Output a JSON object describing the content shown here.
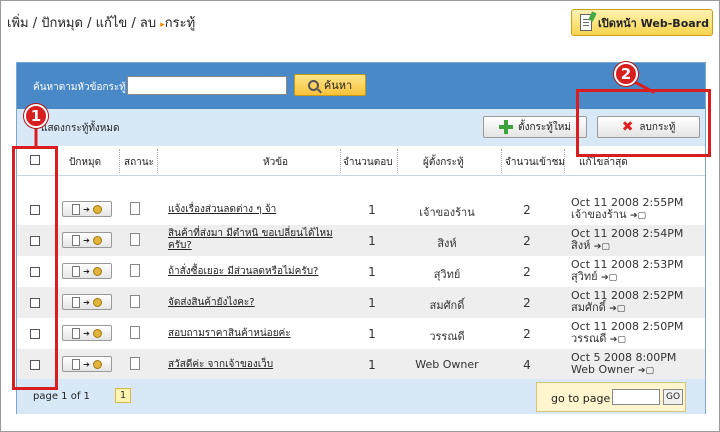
{
  "breadcrumb": {
    "part1": "เพิ่ม / ปักหมุด / แก้ไข / ลบ",
    "arrow": "▸",
    "part2": "กระทู้"
  },
  "webboard_button": {
    "label": "เปิดหน้า Web-Board"
  },
  "search": {
    "label": "ค้นหาตามหัวข้อกระทู้",
    "value": "",
    "button_label": "ค้นหา"
  },
  "toolbar": {
    "show_all": "แสดงกระทู้ทั้งหมด",
    "new_topic_label": "ตั้งกระทู้ใหม่",
    "delete_label": "ลบกระทู้"
  },
  "columns": {
    "pin": "ปักหมุด",
    "status": "สถานะ",
    "subject": "หัวข้อ",
    "replies": "จำนวนตอบ",
    "author": "ผู้ตั้งกระทู้",
    "views": "จำนวนเข้าชม",
    "last_post": "แก้ไขล่าสุด"
  },
  "rows": [
    {
      "subject": "แจ้งเรื่องส่วนลดต่าง ๆ จ้า",
      "subject2": "",
      "replies": "1",
      "author": "เจ้าของร้าน",
      "views": "2",
      "last_date": "Oct 11 2008 2:55PM",
      "last_by": "เจ้าของร้าน"
    },
    {
      "subject": "สินค้าที่ส่งมา มีตำหนิ ขอเปลี่ยนได้ไหม",
      "subject2": "ครับ?",
      "replies": "1",
      "author": "สิงห์",
      "views": "2",
      "last_date": "Oct 11 2008 2:54PM",
      "last_by": "สิงห์"
    },
    {
      "subject": "ถ้าสั่งซื้อเยอะ มีส่วนลดหรือไม่ครับ?",
      "subject2": "",
      "replies": "1",
      "author": "สุวิทย์",
      "views": "2",
      "last_date": "Oct 11 2008 2:53PM",
      "last_by": "สุวิทย์"
    },
    {
      "subject": "จัดส่งสินค้ายังไงคะ?",
      "subject2": "",
      "replies": "1",
      "author": "สมศักดิ์",
      "views": "2",
      "last_date": "Oct 11 2008 2:52PM",
      "last_by": "สมศักดิ์"
    },
    {
      "subject": "สอบถามราคาสินค้าหน่อยค่ะ",
      "subject2": "",
      "replies": "1",
      "author": "วรรณดี",
      "views": "2",
      "last_date": "Oct 11 2008 2:50PM",
      "last_by": "วรรณดี"
    },
    {
      "subject": "สวัสดีค่ะ จากเจ้าของเว็บ",
      "subject2": "",
      "replies": "1",
      "author": "Web Owner",
      "views": "4",
      "last_date": "Oct 5 2008 8:00PM",
      "last_by": "Web Owner"
    }
  ],
  "footer": {
    "page_info": "page 1 of 1",
    "current_page": "1",
    "goto_label": "go to page",
    "goto_value": "",
    "goto_button": "GO"
  },
  "annotations": {
    "marker1": "1",
    "marker2": "2",
    "color": "#d81e1e"
  },
  "go_arrow": "➔▢",
  "move_arrow": "➔"
}
